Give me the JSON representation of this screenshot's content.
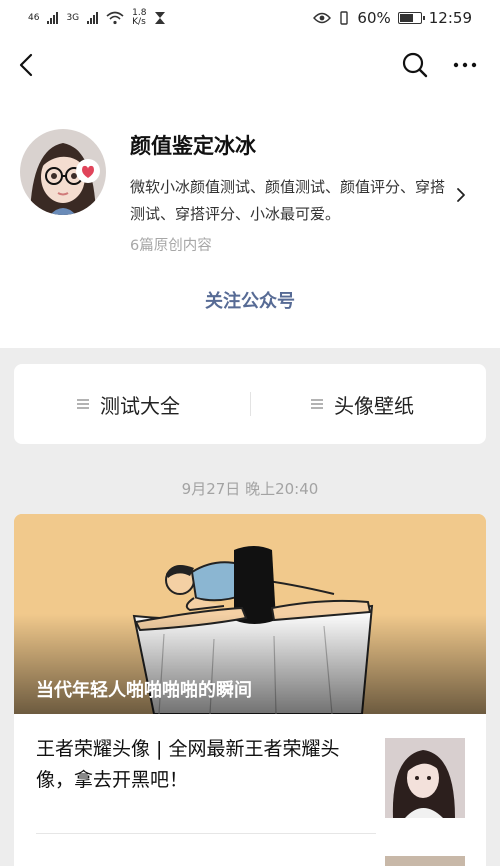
{
  "status_bar": {
    "net1": "46",
    "net2": "3G",
    "speed": "1.8\nK/s",
    "battery": "60%",
    "time": "12:59"
  },
  "profile": {
    "name": "颜值鉴定冰冰",
    "description": "微软小冰颜值测试、颜值测试、颜值评分、穿搭测试、穿搭评分、小冰最可爱。",
    "article_count": "6篇原创内容",
    "follow_label": "关注公众号"
  },
  "menu": {
    "items": [
      {
        "label": "测试大全"
      },
      {
        "label": "头像壁纸"
      }
    ]
  },
  "feed": {
    "date": "9月27日 晚上20:40",
    "cover_title": "当代年轻人啪啪啪啪的瞬间",
    "articles": [
      {
        "title": "王者荣耀头像 | 全网最新王者荣耀头像，拿去开黑吧！"
      }
    ]
  },
  "icons": {
    "back": "chevron-left-icon",
    "search": "search-icon",
    "more": "more-icon"
  },
  "colors": {
    "link": "#576b95",
    "background": "#ededed",
    "cover_bg": "#f1c98c"
  }
}
